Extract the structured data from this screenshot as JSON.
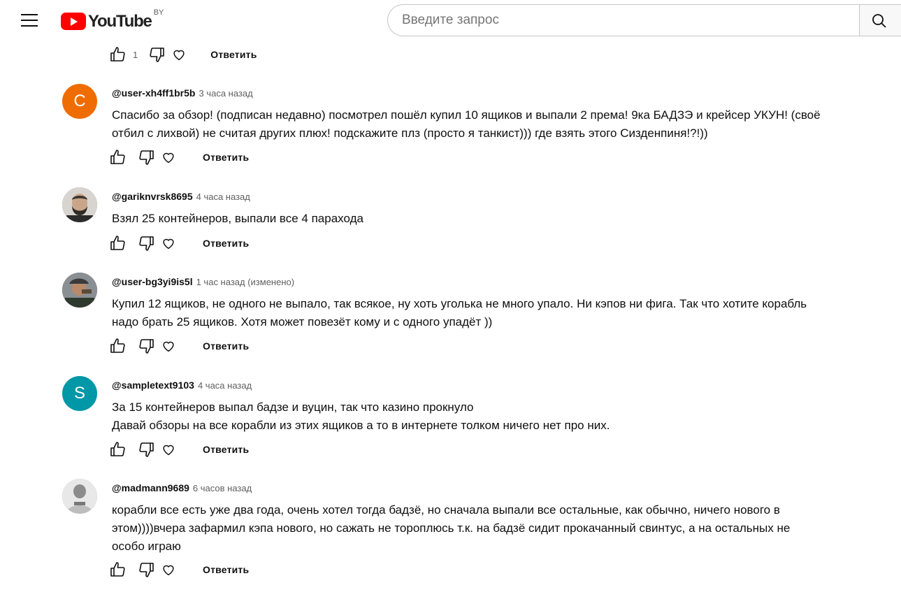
{
  "header": {
    "logo_text": "YouTube",
    "region": "BY",
    "search_placeholder": "Введите запрос",
    "brand_color": "#ff0000"
  },
  "top_actions": {
    "like_count": "1",
    "reply_label": "Ответить"
  },
  "comments": [
    {
      "author": "@user-xh4ff1br5b",
      "time": "3 часа назад",
      "avatar_letter": "C",
      "avatar_color": "#ef6c00",
      "lines": [
        "Спасибо за обзор! (подписан недавно) посмотрел пошёл купил 10 ящиков и выпали 2 према! 9ка БАДЗЭ и крейсер УКУН! (своё",
        "отбил с лихвой) не считая других плюх!  подскажите плз (просто я танкист))) где взять этого Сизденпиня!?!))"
      ],
      "reply_label": "Ответить"
    },
    {
      "author": "@gariknvrsk8695",
      "time": "4 часа назад",
      "avatar_letter": "",
      "avatar_color": "#6b5f55",
      "lines": [
        "Взял 25 контейнеров, выпали все 4 парахода"
      ],
      "reply_label": "Ответить"
    },
    {
      "author": "@user-bg3yi9is5l",
      "time": "1 час назад (изменено)",
      "avatar_letter": "",
      "avatar_color": "#4a4a4a",
      "lines": [
        "Купил 12 ящиков, не одного не  выпало, так всякое, ну хоть уголька не много упало. Ни кэпов ни фига. Так что хотите корабль",
        "надо брать 25 ящиков. Хотя может повезёт кому и с одного упадёт ))"
      ],
      "reply_label": "Ответить"
    },
    {
      "author": "@sampletext9103",
      "time": "4 часа назад",
      "avatar_letter": "S",
      "avatar_color": "#0097a7",
      "lines": [
        "За 15 контейнеров выпал бадзе и вуцин, так что казино прокнуло",
        "Давай обзоры на все корабли из этих ящиков а то в интернете толком ничего нет про них."
      ],
      "reply_label": "Ответить"
    },
    {
      "author": "@madmann9689",
      "time": "6 часов назад",
      "avatar_letter": "",
      "avatar_color": "#9e9e9e",
      "lines": [
        "корабли все есть уже два года, очень хотел тогда бадзё, но сначала выпали все остальные, как обычно, ничего нового в",
        "этом))))вчера зафармил кэпа нового, но сажать не тороплюсь т.к. на бадзё сидит прокачанный свинтус, а на остальных не",
        "особо играю"
      ],
      "reply_label": "Ответить"
    }
  ]
}
